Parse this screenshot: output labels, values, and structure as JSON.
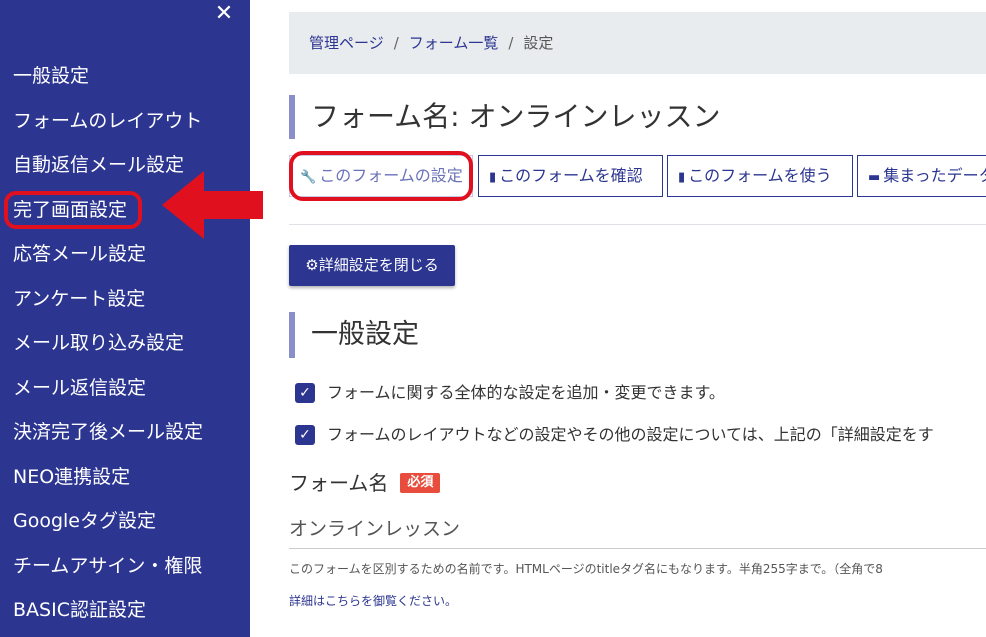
{
  "sidebar": {
    "close_glyph": "✕",
    "items": [
      {
        "label": "一般設定"
      },
      {
        "label": "フォームのレイアウト"
      },
      {
        "label": "自動返信メール設定"
      },
      {
        "label": "完了画面設定"
      },
      {
        "label": "応答メール設定"
      },
      {
        "label": "アンケート設定"
      },
      {
        "label": "メール取り込み設定"
      },
      {
        "label": "メール返信設定"
      },
      {
        "label": "決済完了後メール設定"
      },
      {
        "label": "NEO連携設定"
      },
      {
        "label": "Googleタグ設定"
      },
      {
        "label": "チームアサイン・権限"
      },
      {
        "label": "BASIC認証設定"
      }
    ]
  },
  "breadcrumb": {
    "items": [
      "管理ページ",
      "フォーム一覧",
      "設定"
    ],
    "separator": "/"
  },
  "page_title": "フォーム名: オンラインレッスン",
  "action_buttons": [
    {
      "label": "このフォームの設定",
      "icon": "wrench-icon",
      "glyph": "🔧"
    },
    {
      "label": "このフォームを確認",
      "icon": "document-icon",
      "glyph": "▮"
    },
    {
      "label": "このフォームを使う",
      "icon": "document-lines-icon",
      "glyph": "▮"
    },
    {
      "label": "集まったデータ",
      "icon": "comment-icon",
      "glyph": "▬"
    }
  ],
  "toggle_button": {
    "label": "詳細設定を閉じる",
    "icon": "gear-icon",
    "glyph": "⚙"
  },
  "section_title": "一般設定",
  "checks": [
    {
      "label": "フォームに関する全体的な設定を追加・変更できます。",
      "checked": true
    },
    {
      "label": "フォームのレイアウトなどの設定やその他の設定については、上記の「詳細設定をす",
      "checked": true
    }
  ],
  "form_name_field": {
    "label": "フォーム名",
    "required_badge": "必須",
    "value": "オンラインレッスン",
    "help": "このフォームを区別するための名前です。HTMLページのtitleタグ名にもなります。半角255字まで。（全角で8",
    "help_link": "詳細はこちらを御覧ください。"
  },
  "colors": {
    "sidebar_bg": "#2c3590",
    "accent": "#2c3590",
    "annotation_red": "#e0101e",
    "required_badge": "#e74c3c"
  }
}
